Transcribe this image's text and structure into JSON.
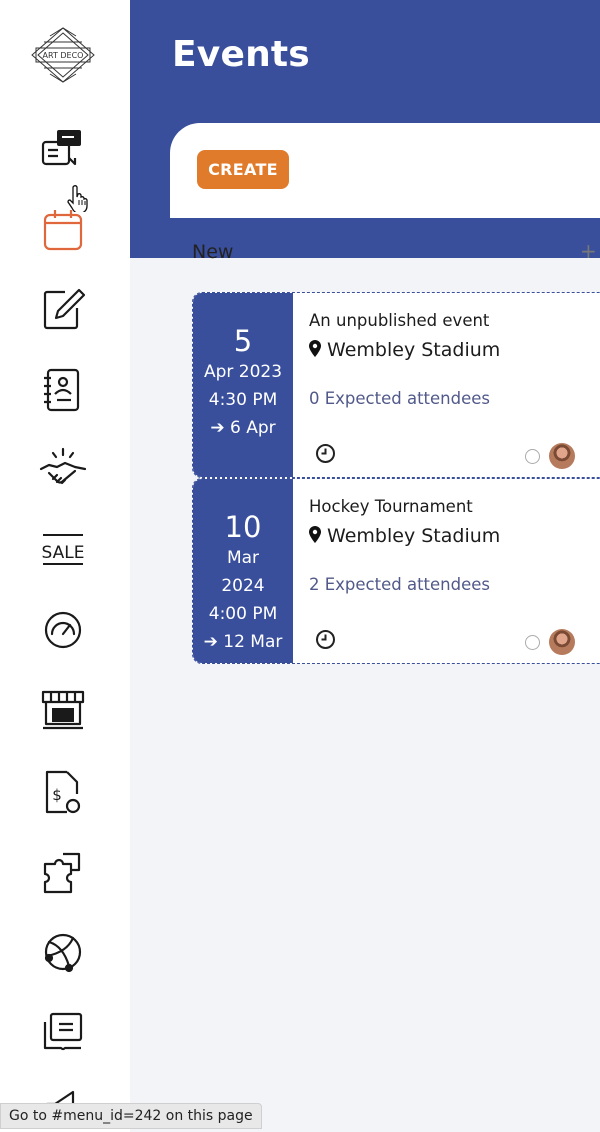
{
  "logo": {
    "text": "ART DECO"
  },
  "sidebar": {
    "items": [
      {
        "icon": "discuss-icon"
      },
      {
        "icon": "calendar-icon",
        "active": true
      },
      {
        "icon": "notes-icon"
      },
      {
        "icon": "contacts-icon"
      },
      {
        "icon": "crm-handshake-icon"
      },
      {
        "icon": "sales-icon",
        "text": "SALE"
      },
      {
        "icon": "dashboard-gauge-icon"
      },
      {
        "icon": "point-of-sale-shop-icon"
      },
      {
        "icon": "invoicing-icon"
      },
      {
        "icon": "apps-puzzle-icon"
      },
      {
        "icon": "website-globe-icon"
      },
      {
        "icon": "elearning-book-icon"
      },
      {
        "icon": "marketing-megaphone-icon"
      }
    ]
  },
  "header": {
    "title": "Events"
  },
  "toolbar": {
    "create_label": "CREATE"
  },
  "kanban": {
    "column_title": "New",
    "add_label": "+",
    "cards": [
      {
        "day": "5",
        "month_year": "Apr 2023",
        "time": "4:30 PM",
        "end": "6 Apr",
        "name": "An unpublished event",
        "location": "Wembley Stadium",
        "attendees": "0 Expected attendees"
      },
      {
        "day": "10",
        "month": "Mar",
        "year": "2024",
        "time": "4:00 PM",
        "end": "12 Mar",
        "name": "Hockey Tournament",
        "location": "Wembley Stadium",
        "attendees": "2 Expected attendees"
      }
    ]
  },
  "status_bar": {
    "text": "Go to #menu_id=242 on this page"
  },
  "colors": {
    "primary": "#394f9c",
    "accent": "#e07b2b",
    "active_icon": "#e0663c",
    "attendee_text": "#51598a"
  }
}
